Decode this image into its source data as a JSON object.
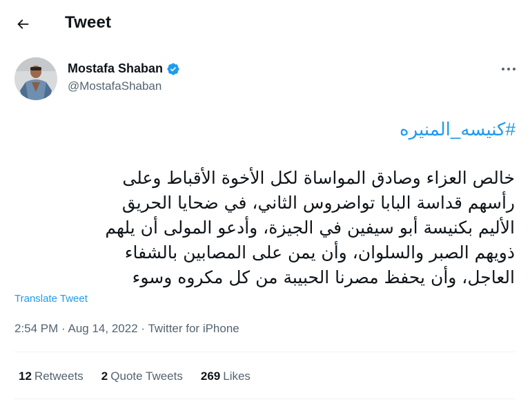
{
  "header": {
    "title": "Tweet",
    "back_icon": "arrow-left-icon"
  },
  "author": {
    "name": "Mostafa Shaban",
    "handle": "@MostafaShaban",
    "verified": true,
    "verified_color": "#1d9bf0"
  },
  "more_icon": "more-horizontal-icon",
  "tweet": {
    "hashtag": "#كنيسه_المنيره",
    "lines": [
      "خالص العزاء وصادق المواساة لكل الأخوة الأقباط وعلى",
      "رأسهم قداسة البابا تواضروس الثاني، في ضحايا الحريق",
      "الأليم بكنيسة أبو سيفين في الجيزة، وأدعو المولى أن يلهم",
      "ذويهم الصبر والسلوان، وأن يمن على المصابين بالشفاء",
      "العاجل، وأن يحفظ مصرنا الحبيبة من كل مكروه وسوء"
    ],
    "translate_label": "Translate Tweet"
  },
  "meta": {
    "time": "2:54 PM",
    "separator": "·",
    "date": "Aug 14, 2022",
    "source": "Twitter for iPhone"
  },
  "stats": {
    "retweets_count": "12",
    "retweets_label": "Retweets",
    "quotes_count": "2",
    "quotes_label": "Quote Tweets",
    "likes_count": "269",
    "likes_label": "Likes"
  },
  "colors": {
    "accent": "#1d9bf0",
    "text": "#0f1419",
    "secondary": "#536471",
    "divider": "#eff3f4"
  }
}
